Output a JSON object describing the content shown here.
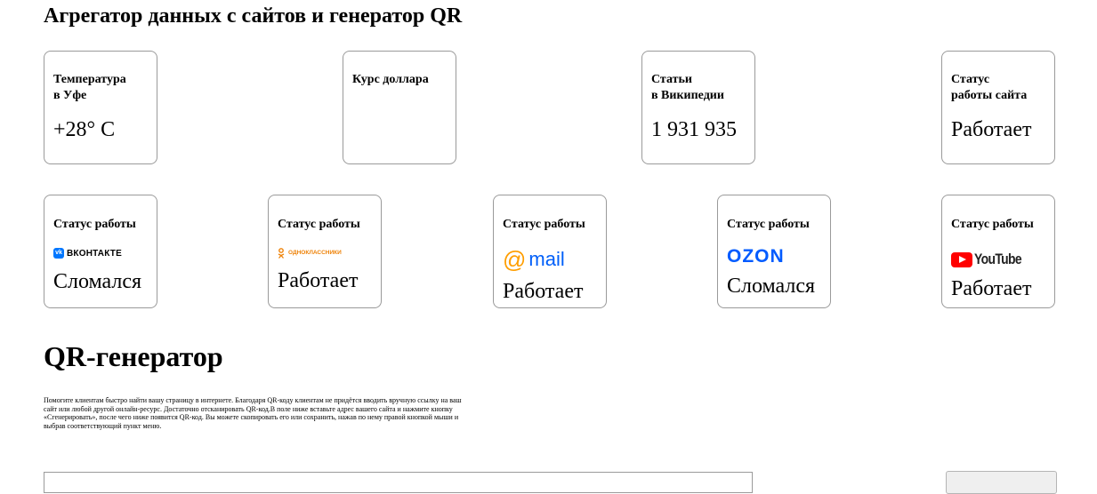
{
  "page": {
    "title": "Агрегатор данных с сайтов и генератор QR"
  },
  "widgets": [
    {
      "label_line1": "Температура",
      "label_line2": "в Уфе",
      "value": "+28° C"
    },
    {
      "label_line1": "Курс доллара",
      "label_line2": "",
      "value": ""
    },
    {
      "label_line1": "Статьи",
      "label_line2": "в Википедии",
      "value": "1 931 935"
    },
    {
      "label_line1": "Статус",
      "label_line2": "работы сайта",
      "value": "Работает"
    }
  ],
  "services": [
    {
      "label": "Статус работы",
      "logo_text": "ВКОНТАКТЕ",
      "logo_icon": "vk-icon",
      "brand_color": "#0077ff",
      "status": "Сломался"
    },
    {
      "label": "Статус работы",
      "logo_text": "ОДНОКЛАССНИКИ",
      "logo_icon": "ok-icon",
      "brand_color": "#ee8208",
      "status": "Работает"
    },
    {
      "label": "Статус работы",
      "logo_text": "mail",
      "logo_icon": "at-sign-icon",
      "brand_color": "#ff9e00",
      "brand_color_2": "#005ff9",
      "status": "Работает"
    },
    {
      "label": "Статус работы",
      "logo_text": "OZON",
      "logo_icon": "",
      "brand_color": "#005bff",
      "status": "Сломался"
    },
    {
      "label": "Статус работы",
      "logo_text": "YouTube",
      "logo_icon": "play-icon",
      "brand_color": "#ff0000",
      "status": "Работает"
    }
  ],
  "qr": {
    "heading": "QR-генератор",
    "description": "Помогите клиентам быстро найти вашу страницу в интернете. Благодаря QR-коду клиентам не придётся вводить вручную ссылку на ваш сайт или любой другой онлайн-ресурс. Достаточно отсканировать QR-код.В поле ниже вставьте адрес вашего сайта и нажмите кнопку «Сгенерировать», после чего ниже появится QR-код. Вы можете скопировать его или сохранить, нажав по нему правой кнопкой мыши и выбрав соответствующий пункт меню.",
    "input_value": "",
    "input_placeholder": "",
    "button_label": ""
  }
}
